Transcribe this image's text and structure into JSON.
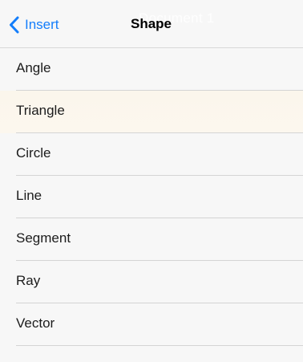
{
  "navbar": {
    "back_label": "Insert",
    "title": "Shape",
    "ghost_title": "Document 1"
  },
  "colors": {
    "accent": "#147efb",
    "highlight_row": "#fbf6ec",
    "separator": "#d4d4d4",
    "background": "#f7f7f7"
  },
  "icons": {
    "back": "chevron-left-icon"
  },
  "shapes": [
    {
      "label": "Angle"
    },
    {
      "label": "Triangle"
    },
    {
      "label": "Circle"
    },
    {
      "label": "Line"
    },
    {
      "label": "Segment"
    },
    {
      "label": "Ray"
    },
    {
      "label": "Vector"
    }
  ]
}
